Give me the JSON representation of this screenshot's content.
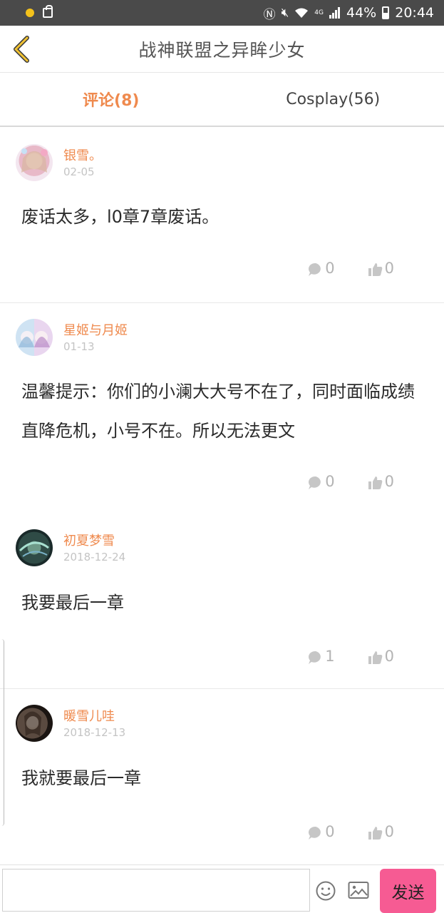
{
  "status_bar": {
    "battery": "44%",
    "time": "20:44",
    "network": "4G"
  },
  "header": {
    "title": "战神联盟之异眸少女",
    "back_icon": "chevron-left-icon"
  },
  "tabs": [
    {
      "label": "评论(8)",
      "active": true
    },
    {
      "label": "Cosplay(56)",
      "active": false
    }
  ],
  "comments": [
    {
      "user": "银雪。",
      "date": "02-05",
      "text": "废话太多，l0章7章废话。",
      "replies": "0",
      "likes": "0"
    },
    {
      "user": "星姬与月姬",
      "date": "01-13",
      "text": "温馨提示：你们的小澜大大号不在了，同时面临成绩直降危机，小号不在。所以无法更文",
      "replies": "0",
      "likes": "0"
    },
    {
      "user": "初夏梦雪",
      "date": "2018-12-24",
      "text": "我要最后一章",
      "replies": "1",
      "likes": "0"
    },
    {
      "user": "暖雪儿哇",
      "date": "2018-12-13",
      "text": "我就要最后一章",
      "replies": "0",
      "likes": "0"
    }
  ],
  "composer": {
    "value": "",
    "send_label": "发送"
  },
  "colors": {
    "accent": "#ef8a4e",
    "send_button": "#f65b93"
  }
}
